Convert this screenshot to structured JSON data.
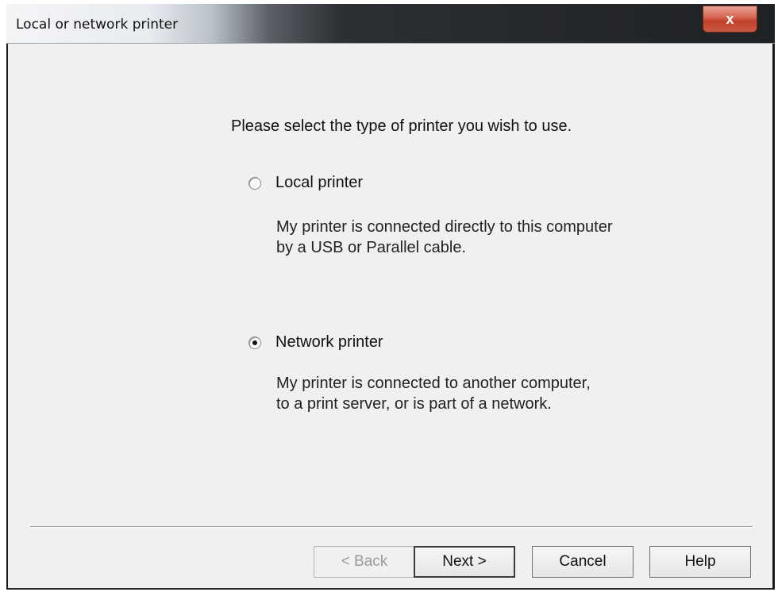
{
  "window": {
    "title": "Local or network printer",
    "close_label": "x"
  },
  "prompt": "Please select the type of printer you wish to use.",
  "options": [
    {
      "label": "Local printer",
      "selected": false,
      "description_line1": "My printer is connected directly to this computer",
      "description_line2": "by a USB or Parallel cable."
    },
    {
      "label": "Network printer",
      "selected": true,
      "description_line1": "My printer is connected to another computer,",
      "description_line2": "to a print server, or is part of a network."
    }
  ],
  "buttons": {
    "back": "< Back",
    "next": "Next >",
    "cancel": "Cancel",
    "help": "Help"
  },
  "colors": {
    "window_bg": "#f0f0f0",
    "close_button": "#c2402a"
  }
}
